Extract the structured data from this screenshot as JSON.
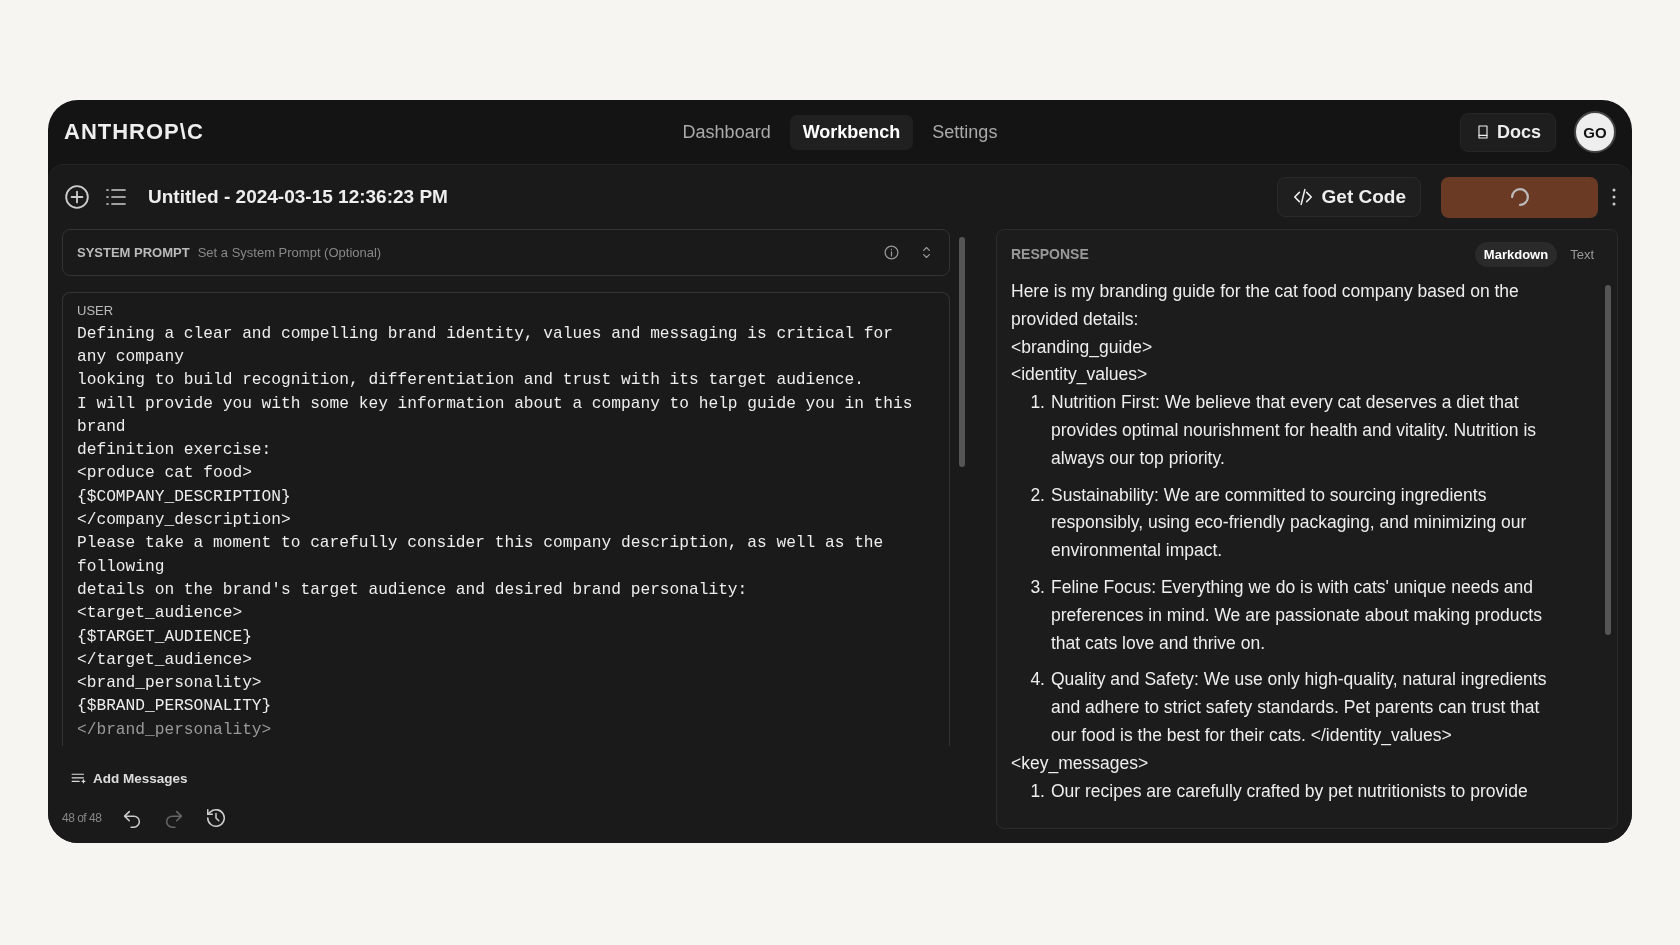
{
  "header": {
    "logo": "ANTHROP\\C",
    "nav": [
      {
        "label": "Dashboard",
        "selected": false
      },
      {
        "label": "Workbench",
        "selected": true
      },
      {
        "label": "Settings",
        "selected": false
      }
    ],
    "docs": "Docs",
    "avatar": "GO"
  },
  "toolbar": {
    "title": "Untitled - 2024-03-15 12:36:23 PM",
    "get_code": "Get Code"
  },
  "system_prompt": {
    "label": "SYSTEM PROMPT",
    "placeholder": "Set a System Prompt (Optional)"
  },
  "user_message": {
    "role": "USER",
    "lines": [
      "Defining a clear and compelling brand identity, values and messaging is critical for",
      "any company",
      "looking to build recognition, differentiation and trust with its target audience.",
      "I will provide you with some key information about a company to help guide you in this",
      "brand",
      "definition exercise:",
      "<produce cat food>",
      "{$COMPANY_DESCRIPTION}",
      "</company_description>",
      "Please take a moment to carefully consider this company description, as well as the",
      "following",
      "details on the brand's target audience and desired brand personality:",
      "<target_audience>",
      "{$TARGET_AUDIENCE}",
      "</target_audience>",
      "<brand_personality>",
      "{$BRAND_PERSONALITY}",
      "</brand_personality>"
    ]
  },
  "add_messages": "Add Messages",
  "history": {
    "count": "48 of 48"
  },
  "response": {
    "label": "RESPONSE",
    "modes": [
      {
        "label": "Markdown",
        "selected": true
      },
      {
        "label": "Text",
        "selected": false
      }
    ],
    "blocks": [
      {
        "kind": "text",
        "text": "Here is my branding guide for the cat food company based on the provided details:"
      },
      {
        "kind": "text",
        "text": "<branding_guide>"
      },
      {
        "kind": "text",
        "text": "<identity_values>"
      },
      {
        "kind": "list",
        "items": [
          {
            "number": "1.",
            "text": "Nutrition First: We believe that every cat deserves a diet that provides optimal nourishment for health and vitality. Nutrition is always our top priority."
          },
          {
            "number": "2.",
            "text": "Sustainability: We are committed to sourcing ingredients responsibly, using eco-friendly packaging, and minimizing our environmental impact."
          },
          {
            "number": "3.",
            "text": "Feline Focus: Everything we do is with cats' unique needs and preferences in mind. We are passionate about making products that cats love and thrive on."
          },
          {
            "number": "4.",
            "text": "Quality and Safety: We use only high-quality, natural ingredients and adhere to strict safety standards. Pet parents can trust that our food is the best for their cats. </identity_values>"
          }
        ]
      },
      {
        "kind": "text",
        "text": "<key_messages>"
      },
      {
        "kind": "list",
        "items": [
          {
            "number": "1.",
            "text": "Our recipes are carefully crafted by pet nutritionists to provide"
          }
        ]
      }
    ]
  }
}
